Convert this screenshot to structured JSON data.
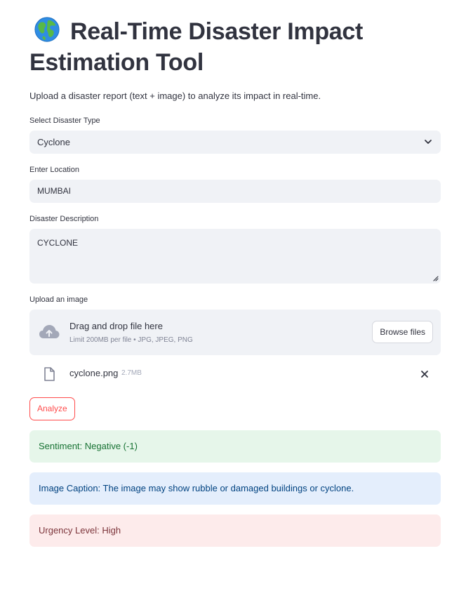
{
  "app": {
    "title": "Real-Time Disaster Impact Estimation Tool",
    "title_icon": "globe-icon",
    "intro": "Upload a disaster report (text + image) to analyze its impact in real-time."
  },
  "form": {
    "disaster_type": {
      "label": "Select Disaster Type",
      "value": "Cyclone"
    },
    "location": {
      "label": "Enter Location",
      "value": "MUMBAI"
    },
    "description": {
      "label": "Disaster Description",
      "value": "CYCLONE"
    },
    "upload": {
      "label": "Upload an image",
      "drop_title": "Drag and drop file here",
      "drop_hint": "Limit 200MB per file • JPG, JPEG, PNG",
      "browse_label": "Browse files"
    },
    "uploaded_file": {
      "name": "cyclone.png",
      "size": "2.7MB"
    },
    "analyze_label": "Analyze"
  },
  "results": {
    "sentiment": "Sentiment: Negative (-1)",
    "caption": "Image Caption: The image may show rubble or damaged buildings or cyclone.",
    "urgency": "Urgency Level: High"
  },
  "colors": {
    "primary": "#ff4b4b",
    "input_bg": "#f0f2f6",
    "text": "#31333f",
    "success_bg": "#e6f6ea",
    "success_text": "#177233",
    "info_bg": "#e4eefc",
    "info_text": "#004280",
    "error_bg": "#fdebeb",
    "error_text": "#7d353b"
  }
}
